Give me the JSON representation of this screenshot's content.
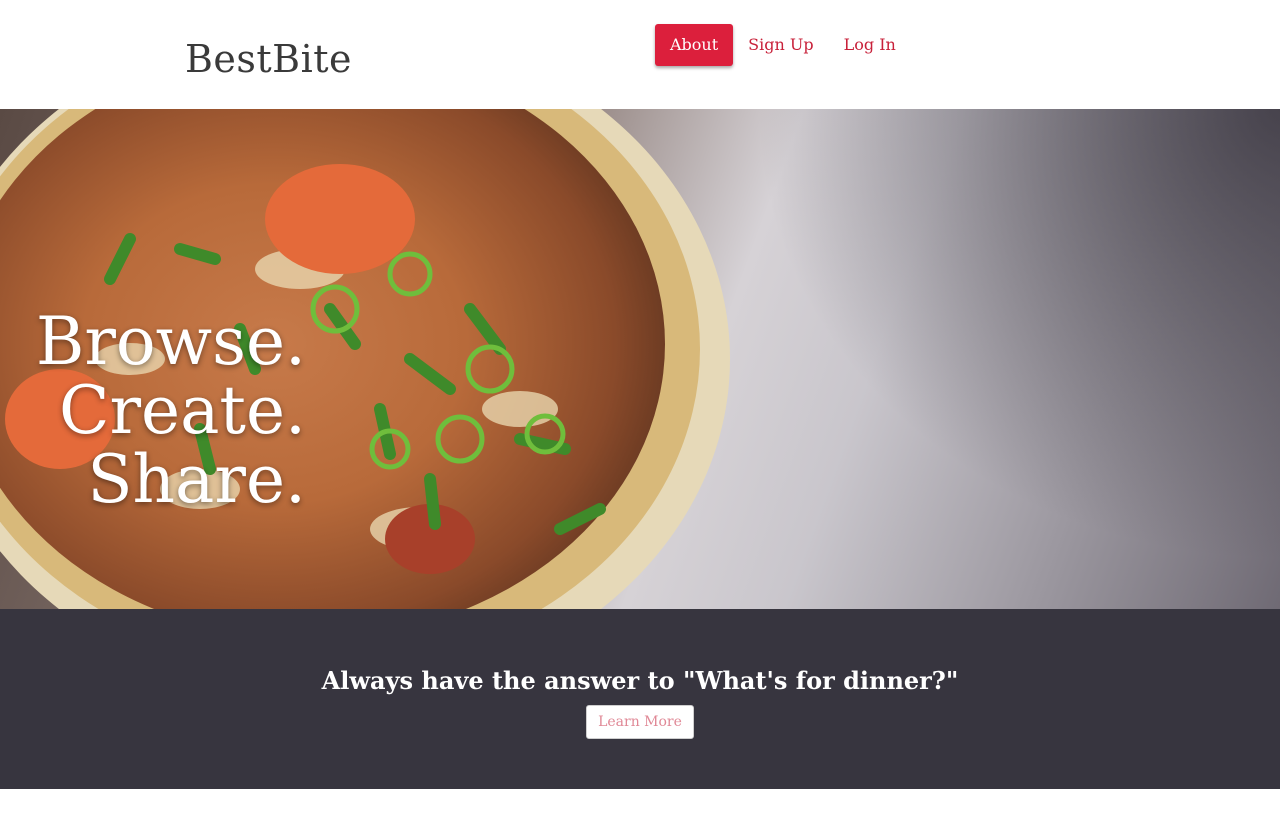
{
  "brand": {
    "name": "BestBite"
  },
  "nav": {
    "items": [
      "About",
      "Sign Up",
      "Log In"
    ],
    "active": "About"
  },
  "hero": {
    "lines": [
      "Browse.",
      "Create.",
      "Share."
    ]
  },
  "cta": {
    "title": "Always have the answer to \"What's for dinner?\"",
    "button": "Learn More"
  },
  "colors": {
    "accent": "#dc1f3c",
    "link": "#c8213a",
    "band": "#37353f"
  }
}
